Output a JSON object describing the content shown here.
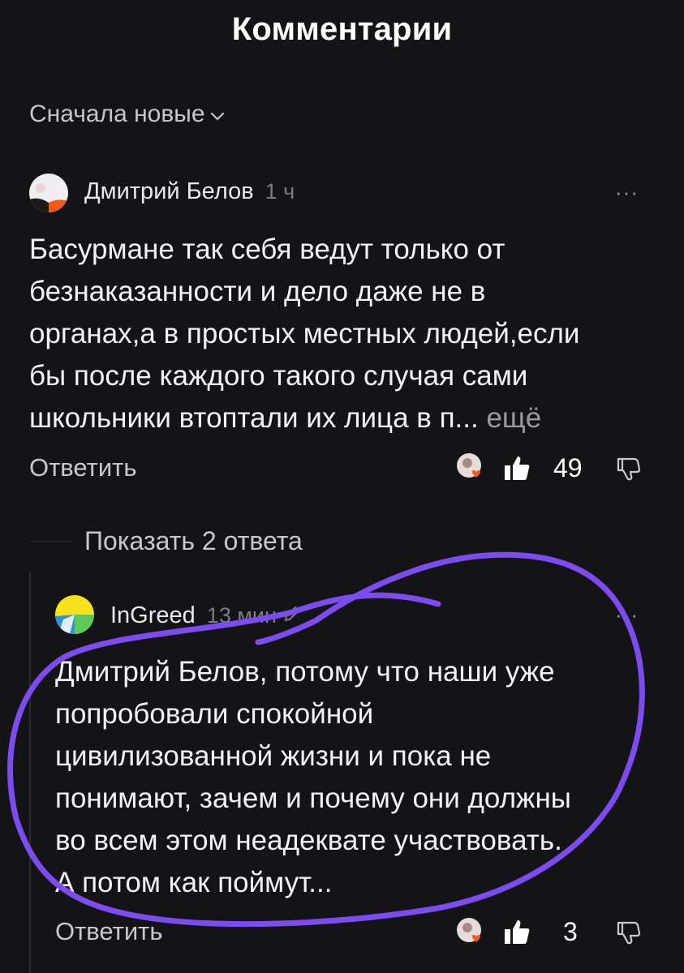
{
  "header": {
    "title": "Комментарии"
  },
  "sort": {
    "label": "Сначала новые"
  },
  "comments": [
    {
      "author": "Дмитрий Белов",
      "time": "1 ч",
      "menu": "···",
      "text_lines": [
        "Басурмане так себя ведут только от",
        "безнаказанности и дело даже не в",
        "органах,а в простых местных людей,если",
        "бы после каждого такого случая сами",
        "школьники втоптали их лица в п..."
      ],
      "more_label": "ещё",
      "reply_label": "Ответить",
      "likes": "49"
    }
  ],
  "show_replies": {
    "label": "Показать 2 ответа"
  },
  "replies": [
    {
      "author": "InGreed",
      "time": "13 мин",
      "menu": "···",
      "text_lines": [
        "Дмитрий Белов, потому что наши уже",
        "попробовали спокойной",
        "цивилизованной жизни и пока не",
        "понимают, зачем и почему они должны",
        "во всем этом неадеквате участвовать.",
        "А потом как поймут..."
      ],
      "reply_label": "Ответить",
      "likes": "3"
    }
  ],
  "colors": {
    "background": "#141316",
    "annotation": "#7d4cf0",
    "accent_orange": "#f05a1a"
  },
  "icons": [
    "chevron-down-icon",
    "more-icon",
    "reactor-avatar-icon",
    "thumbs-up-icon",
    "thumbs-down-icon",
    "edit-pencil-icon"
  ]
}
